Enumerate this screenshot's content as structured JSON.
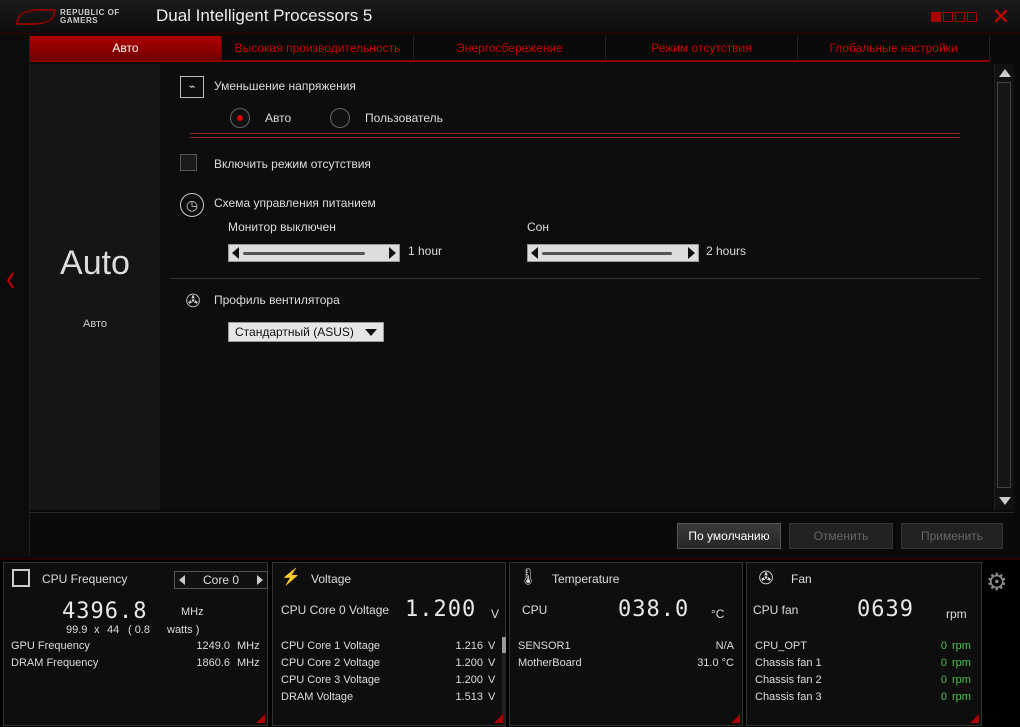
{
  "window": {
    "title": "Dual Intelligent Processors 5",
    "logo_text_1": "REPUBLIC OF",
    "logo_text_2": "GAMERS",
    "close": "✕"
  },
  "tabs": [
    {
      "label": "Авто",
      "active": true
    },
    {
      "label": "Высокая производительность"
    },
    {
      "label": "Энергосбережение"
    },
    {
      "label": "Режим отсутствия"
    },
    {
      "label": "Глобальные настройки"
    }
  ],
  "mode": {
    "big": "Auto",
    "small": "Авто"
  },
  "voltage": {
    "title": "Уменьшение напряжения",
    "auto": "Авто",
    "user": "Пользователь",
    "icon": "waveform-icon"
  },
  "away": {
    "label": "Включить режим отсутствия"
  },
  "power": {
    "title": "Схема управления питанием",
    "monitor_label": "Монитор выключен",
    "monitor_value": "1 hour",
    "monitor_fill": 0.85,
    "sleep_label": "Сон",
    "sleep_value": "2 hours",
    "sleep_fill": 0.9
  },
  "fan": {
    "title": "Профиль вентилятора",
    "selected": "Стандартный (ASUS)"
  },
  "buttons": {
    "default": "По умолчанию",
    "cancel": "Отменить",
    "apply": "Применить"
  },
  "monitor": {
    "cpu": {
      "title": "CPU Frequency",
      "core": "Core 0",
      "freq": "4396.8",
      "unit": "MHz",
      "detail_1": "99.9",
      "detail_x": "x",
      "detail_2": "44",
      "detail_3": "( 0.8",
      "detail_w": "watts )",
      "rows": [
        {
          "label": "GPU Frequency",
          "value": "1249.0",
          "unit": "MHz"
        },
        {
          "label": "DRAM Frequency",
          "value": "1860.6",
          "unit": "MHz"
        }
      ]
    },
    "voltage": {
      "title": "Voltage",
      "main_label": "CPU Core 0 Voltage",
      "main_value": "1.200",
      "main_unit": "V",
      "rows": [
        {
          "label": "CPU Core 1 Voltage",
          "value": "1.216",
          "unit": "V"
        },
        {
          "label": "CPU Core 2 Voltage",
          "value": "1.200",
          "unit": "V"
        },
        {
          "label": "CPU Core 3 Voltage",
          "value": "1.200",
          "unit": "V"
        },
        {
          "label": "DRAM Voltage",
          "value": "1.513",
          "unit": "V"
        }
      ]
    },
    "temperature": {
      "title": "Temperature",
      "main_label": "CPU",
      "main_value": "038.0",
      "main_unit": "°C",
      "rows": [
        {
          "label": "SENSOR1",
          "value": "N/A"
        },
        {
          "label": "MotherBoard",
          "value": "31.0 °C"
        }
      ]
    },
    "fan": {
      "title": "Fan",
      "main_label": "CPU fan",
      "main_value": "0639",
      "main_unit": "rpm",
      "rows": [
        {
          "label": "CPU_OPT",
          "value": "0",
          "unit": "rpm"
        },
        {
          "label": "Chassis fan 1",
          "value": "0",
          "unit": "rpm"
        },
        {
          "label": "Chassis fan 2",
          "value": "0",
          "unit": "rpm"
        },
        {
          "label": "Chassis fan 3",
          "value": "0",
          "unit": "rpm"
        }
      ]
    }
  }
}
